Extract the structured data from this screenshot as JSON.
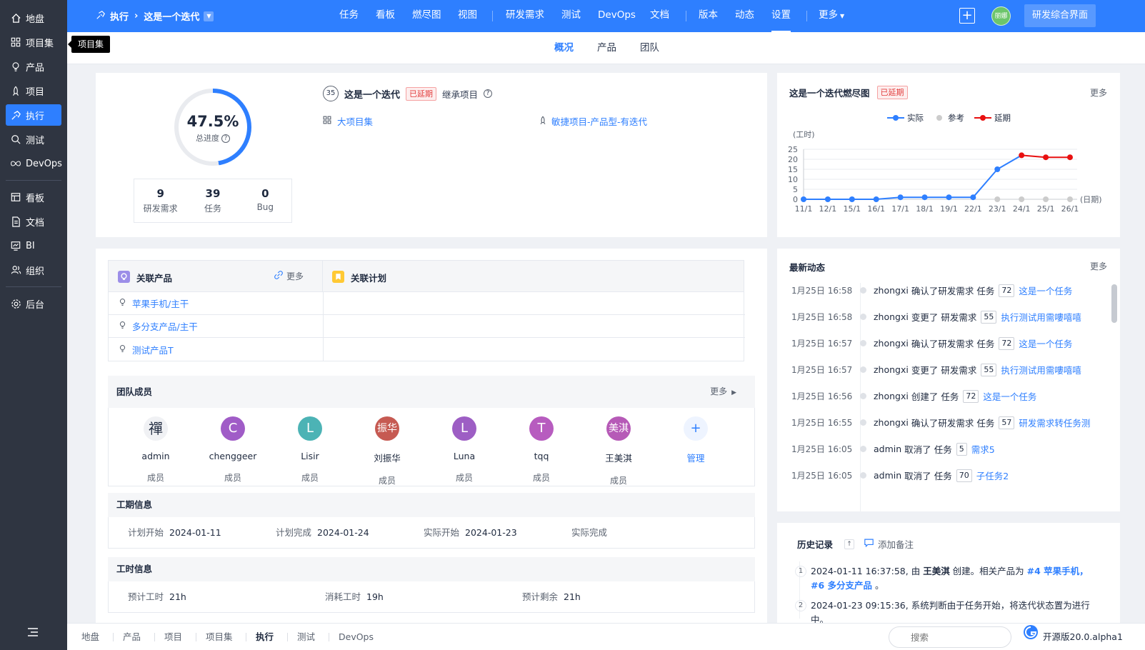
{
  "sidebar": {
    "items": [
      {
        "label": "地盘",
        "icon": "home-icon"
      },
      {
        "label": "项目集",
        "icon": "grid-icon"
      },
      {
        "label": "产品",
        "icon": "bulb-icon"
      },
      {
        "label": "项目",
        "icon": "rocket-icon"
      },
      {
        "label": "执行",
        "icon": "run-icon",
        "active": true
      },
      {
        "label": "测试",
        "icon": "search-icon"
      },
      {
        "label": "DevOps",
        "icon": "infinity-icon"
      },
      {
        "label": "看板",
        "icon": "kanban-icon"
      },
      {
        "label": "文档",
        "icon": "doc-icon"
      },
      {
        "label": "BI",
        "icon": "chart-icon"
      },
      {
        "label": "组织",
        "icon": "people-icon"
      },
      {
        "label": "后台",
        "icon": "gear-icon"
      }
    ],
    "tooltip": "项目集"
  },
  "topbar": {
    "breadcrumb": {
      "section": "执行",
      "current": "这是一个迭代"
    },
    "nav": [
      "任务",
      "看板",
      "燃尽图",
      "视图",
      "研发需求",
      "测试",
      "DevOps",
      "文档",
      "版本",
      "动态",
      "设置",
      "更多"
    ],
    "active_nav": "设置",
    "user_avatar": "丽娜",
    "rd_button": "研发综合界面"
  },
  "subnav": {
    "tabs": [
      "概况",
      "产品",
      "团队"
    ],
    "active": "概况"
  },
  "overview": {
    "progress_pct": "47.5%",
    "progress_value": 47.5,
    "progress_label": "总进度",
    "stats": [
      {
        "n": "9",
        "l": "研发需求"
      },
      {
        "n": "39",
        "l": "任务"
      },
      {
        "n": "0",
        "l": "Bug"
      }
    ],
    "exec_id": "35",
    "exec_name": "这是一个迭代",
    "status": "已延期",
    "inherit": "继承项目",
    "program_link": "大项目集",
    "project_link": "敏捷项目-产品型-有迭代"
  },
  "burndown": {
    "title": "这是一个迭代燃尽图",
    "status": "已延期",
    "more": "更多",
    "legend": [
      "实际",
      "参考",
      "延期"
    ],
    "ylabel": "(工时)",
    "xlabel": "(日期)"
  },
  "chart_data": {
    "type": "line",
    "categories": [
      "11/1",
      "12/1",
      "15/1",
      "16/1",
      "17/1",
      "18/1",
      "19/1",
      "22/1",
      "23/1",
      "24/1",
      "25/1",
      "26/1"
    ],
    "ylim": [
      0,
      25
    ],
    "yticks": [
      0,
      5,
      10,
      15,
      20,
      25
    ],
    "series": [
      {
        "name": "实际",
        "color": "#2e7fff",
        "values": [
          0,
          0,
          0,
          0,
          1,
          1,
          1,
          1,
          15,
          null,
          null,
          null
        ]
      },
      {
        "name": "参考",
        "color": "#cccccc",
        "values": [
          null,
          null,
          null,
          null,
          null,
          null,
          null,
          null,
          0,
          0,
          0,
          0
        ]
      },
      {
        "name": "延期",
        "color": "#e81010",
        "values": [
          null,
          null,
          null,
          null,
          null,
          null,
          null,
          null,
          null,
          22,
          21,
          21
        ]
      }
    ],
    "bridge": {
      "from_index": 8,
      "to_index": 9,
      "from": 15,
      "to": 22
    },
    "ylabel": "(工时)",
    "xlabel": "(日期)",
    "grid": true,
    "legend": "top-center"
  },
  "related": {
    "products_title": "关联产品",
    "products_more": "更多",
    "plans_title": "关联计划",
    "products": [
      "苹果手机/主干",
      "多分支产品/主干",
      "测试产品T"
    ]
  },
  "team": {
    "title": "团队成员",
    "more": "更多",
    "members": [
      {
        "avatar": "禪",
        "name": "admin",
        "role": "成员",
        "color": "#f0f1f4",
        "fg": "#1f2a3f"
      },
      {
        "avatar": "C",
        "name": "chenggeer",
        "role": "成员",
        "color": "#a05cc7",
        "fg": "#ffffff"
      },
      {
        "avatar": "L",
        "name": "Lisir",
        "role": "成员",
        "color": "#4cb3b5",
        "fg": "#ffffff"
      },
      {
        "avatar": "振华",
        "name": "刘振华",
        "role": "成员",
        "color": "#c65a52",
        "fg": "#ffffff"
      },
      {
        "avatar": "L",
        "name": "Luna",
        "role": "成员",
        "color": "#9d5ec4",
        "fg": "#ffffff"
      },
      {
        "avatar": "T",
        "name": "tqq",
        "role": "成员",
        "color": "#b75cbf",
        "fg": "#ffffff"
      },
      {
        "avatar": "美淇",
        "name": "王美淇",
        "role": "成员",
        "color": "#b65ab7",
        "fg": "#ffffff"
      }
    ],
    "manage": "管理"
  },
  "schedule": {
    "title": "工期信息",
    "items": [
      {
        "k": "计划开始",
        "v": "2024-01-11"
      },
      {
        "k": "计划完成",
        "v": "2024-01-24"
      },
      {
        "k": "实际开始",
        "v": "2024-01-23"
      },
      {
        "k": "实际完成",
        "v": ""
      }
    ]
  },
  "hours": {
    "title": "工时信息",
    "items": [
      {
        "k": "预计工时",
        "v": "21h"
      },
      {
        "k": "消耗工时",
        "v": "19h"
      },
      {
        "k": "预计剩余",
        "v": "21h"
      }
    ]
  },
  "activity": {
    "title": "最新动态",
    "more": "更多",
    "rows": [
      {
        "time": "1月25日 16:58",
        "user": "zhongxi",
        "action": "确认了研发需求",
        "type": "任务",
        "id": "72",
        "target": "这是一个任务"
      },
      {
        "time": "1月25日 16:58",
        "user": "zhongxi",
        "action": "变更了",
        "type": "研发需求",
        "id": "55",
        "target": "执行测试用需嘍嘻嘻"
      },
      {
        "time": "1月25日 16:57",
        "user": "zhongxi",
        "action": "确认了研发需求",
        "type": "任务",
        "id": "72",
        "target": "这是一个任务"
      },
      {
        "time": "1月25日 16:57",
        "user": "zhongxi",
        "action": "变更了",
        "type": "研发需求",
        "id": "55",
        "target": "执行测试用需嘍嘻嘻"
      },
      {
        "time": "1月25日 16:56",
        "user": "zhongxi",
        "action": "创建了",
        "type": "任务",
        "id": "72",
        "target": "这是一个任务"
      },
      {
        "time": "1月25日 16:55",
        "user": "zhongxi",
        "action": "确认了研发需求",
        "type": "任务",
        "id": "57",
        "target": "研发需求转任务测"
      },
      {
        "time": "1月25日 16:05",
        "user": "admin",
        "action": "取消了",
        "type": "任务",
        "id": "5",
        "target": "需求5"
      },
      {
        "time": "1月25日 16:05",
        "user": "admin",
        "action": "取消了",
        "type": "任务",
        "id": "70",
        "target": "子任务2"
      }
    ]
  },
  "history": {
    "title": "历史记录",
    "add_note": "添加备注",
    "entries": [
      {
        "no": "1",
        "pre": "2024-01-11 16:37:58, 由 ",
        "user": "王美淇",
        "mid": " 创建。相关产品为 ",
        "links": "#4 苹果手机，#6 多分支产品",
        "post": " 。"
      },
      {
        "no": "2",
        "pre": "2024-01-23 09:15:36, 系统判断由于任务开始，将迭代状态置为进行中。",
        "user": "",
        "mid": "",
        "links": "",
        "post": ""
      }
    ]
  },
  "bottombar": {
    "items": [
      "地盘",
      "产品",
      "项目",
      "项目集",
      "执行",
      "测试",
      "DevOps"
    ],
    "active": "执行",
    "search_placeholder": "搜索",
    "version": "开源版20.0.alpha1"
  }
}
